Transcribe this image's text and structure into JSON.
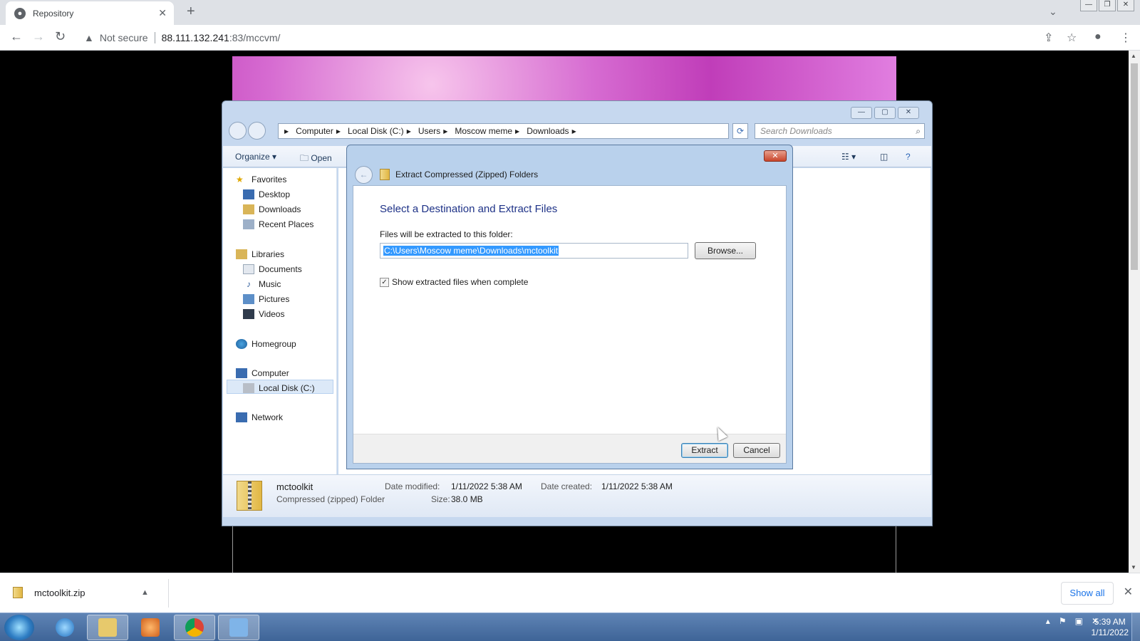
{
  "browser": {
    "tab_title": "Repository",
    "new_tab": "+",
    "tab_close": "✕",
    "security_label": "Not secure",
    "url_host": "88.111.132.241",
    "url_path": ":83/mccvm/",
    "window_buttons": [
      "—",
      "❐",
      "✕"
    ]
  },
  "explorer": {
    "caption_buttons": [
      "—",
      "▢",
      "✕"
    ],
    "breadcrumbs": [
      "Computer",
      "Local Disk (C:)",
      "Users",
      "Moscow meme",
      "Downloads"
    ],
    "search_placeholder": "Search Downloads",
    "organize_label": "Organize ▾",
    "open_label": "Open",
    "nav": {
      "favorites": "Favorites",
      "desktop": "Desktop",
      "downloads": "Downloads",
      "recent": "Recent Places",
      "libraries": "Libraries",
      "documents": "Documents",
      "music": "Music",
      "pictures": "Pictures",
      "videos": "Videos",
      "homegroup": "Homegroup",
      "computer": "Computer",
      "local_disk": "Local Disk (C:)",
      "network": "Network"
    },
    "details": {
      "name": "mctoolkit",
      "type": "Compressed (zipped) Folder",
      "modified_label": "Date modified:",
      "modified_value": "1/11/2022 5:38 AM",
      "size_label": "Size:",
      "size_value": "38.0 MB",
      "created_label": "Date created:",
      "created_value": "1/11/2022 5:38 AM"
    }
  },
  "dialog": {
    "title": "Extract Compressed (Zipped) Folders",
    "heading": "Select a Destination and Extract Files",
    "folder_label": "Files will be extracted to this folder:",
    "path_value": "C:\\Users\\Moscow meme\\Downloads\\mctoolkit",
    "browse_label": "Browse...",
    "show_files_label": "Show extracted files when complete",
    "show_files_checked": true,
    "extract_label": "Extract",
    "cancel_label": "Cancel"
  },
  "downloads": {
    "file_name": "mctoolkit.zip",
    "show_all": "Show all"
  },
  "taskbar": {
    "time": "5:39 AM",
    "date": "1/11/2022"
  }
}
